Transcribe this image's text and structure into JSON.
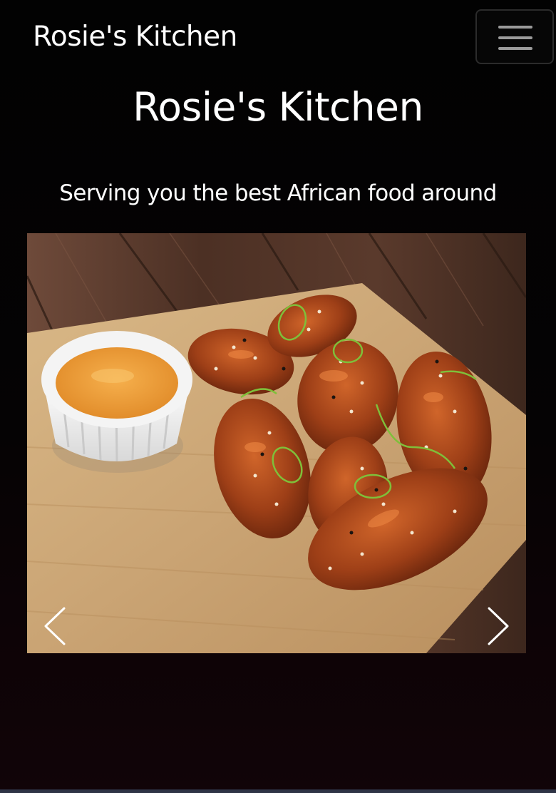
{
  "navbar": {
    "brand": "Rosie's Kitchen",
    "menu_icon": "hamburger-menu-icon"
  },
  "hero": {
    "title": "Rosie's Kitchen",
    "tagline": "Serving you the best African food around"
  },
  "carousel": {
    "image_alt": "Glazed chicken wings with dipping sauce on a wooden board",
    "prev_icon": "chevron-left-icon",
    "next_icon": "chevron-right-icon"
  }
}
